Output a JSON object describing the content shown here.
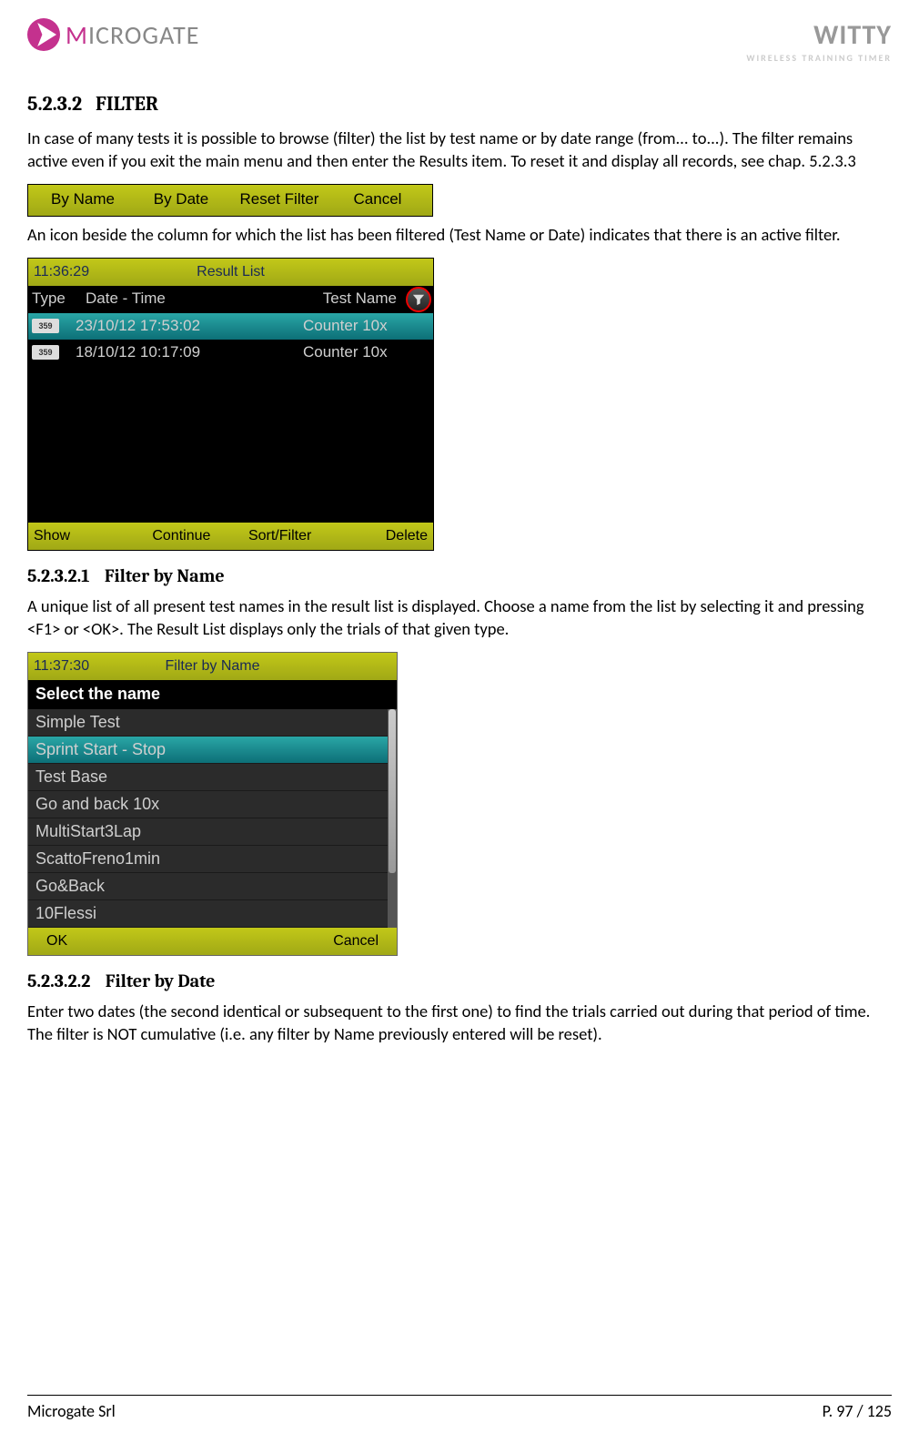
{
  "header": {
    "brand_left_prefix": "M",
    "brand_left_rest": "ICROGATE",
    "brand_right": "WITTY",
    "tagline": "WIRELESS TRAINING TIMER"
  },
  "sec1": {
    "num": "5.2.3.2",
    "title": "FILTER",
    "body": "In case of many tests it is possible to browse (filter) the list by test name or by date range (from... to...). The filter remains active even if you exit the main menu and then enter the Results item. To reset it and display all records, see chap. 5.2.3.3"
  },
  "filterbar": {
    "b1": "By  Name",
    "b2": "By  Date",
    "b3": "Reset  Filter",
    "b4": "Cancel"
  },
  "after_bar": "An icon beside the column for which the list has been filtered (Test Name or Date) indicates that there is an active filter.",
  "resultlist": {
    "time": "11:36:29",
    "title": "Result  List",
    "col_type": "Type",
    "col_dt": "Date - Time",
    "col_tn": "Test  Name",
    "rows": [
      {
        "badge": "359",
        "dt": "23/10/12  17:53:02",
        "tn": "Counter  10x"
      },
      {
        "badge": "359",
        "dt": "18/10/12  10:17:09",
        "tn": "Counter  10x"
      }
    ],
    "f1": "Show",
    "f2": "Continue",
    "f3": "Sort/Filter",
    "f4": "Delete"
  },
  "sub1": {
    "num": "5.2.3.2.1",
    "title": "Filter by Name",
    "body": "A unique list of all present test names in the result list is displayed. Choose a name from the list by selecting it and pressing <F1> or <OK>. The Result List displays only the trials of that given type."
  },
  "nameshot": {
    "time": "11:37:30",
    "title": "Filter  by  Name",
    "prompt": "Select the name",
    "items": [
      "Simple  Test",
      "Sprint  Start - Stop",
      "Test  Base",
      "Go  and  back  10x",
      "MultiStart3Lap",
      "ScattoFreno1min",
      "Go&Back",
      "10Flessi"
    ],
    "selected_index": 1,
    "ok": "OK",
    "cancel": "Cancel"
  },
  "sub2": {
    "num": "5.2.3.2.2",
    "title": "Filter by Date",
    "body": "Enter two dates (the second identical or subsequent to the first one) to find the trials carried out during that period of time. The filter is NOT cumulative (i.e. any filter by Name previously entered will be reset)."
  },
  "footer": {
    "left": "Microgate Srl",
    "right": "P. 97 / 125"
  }
}
